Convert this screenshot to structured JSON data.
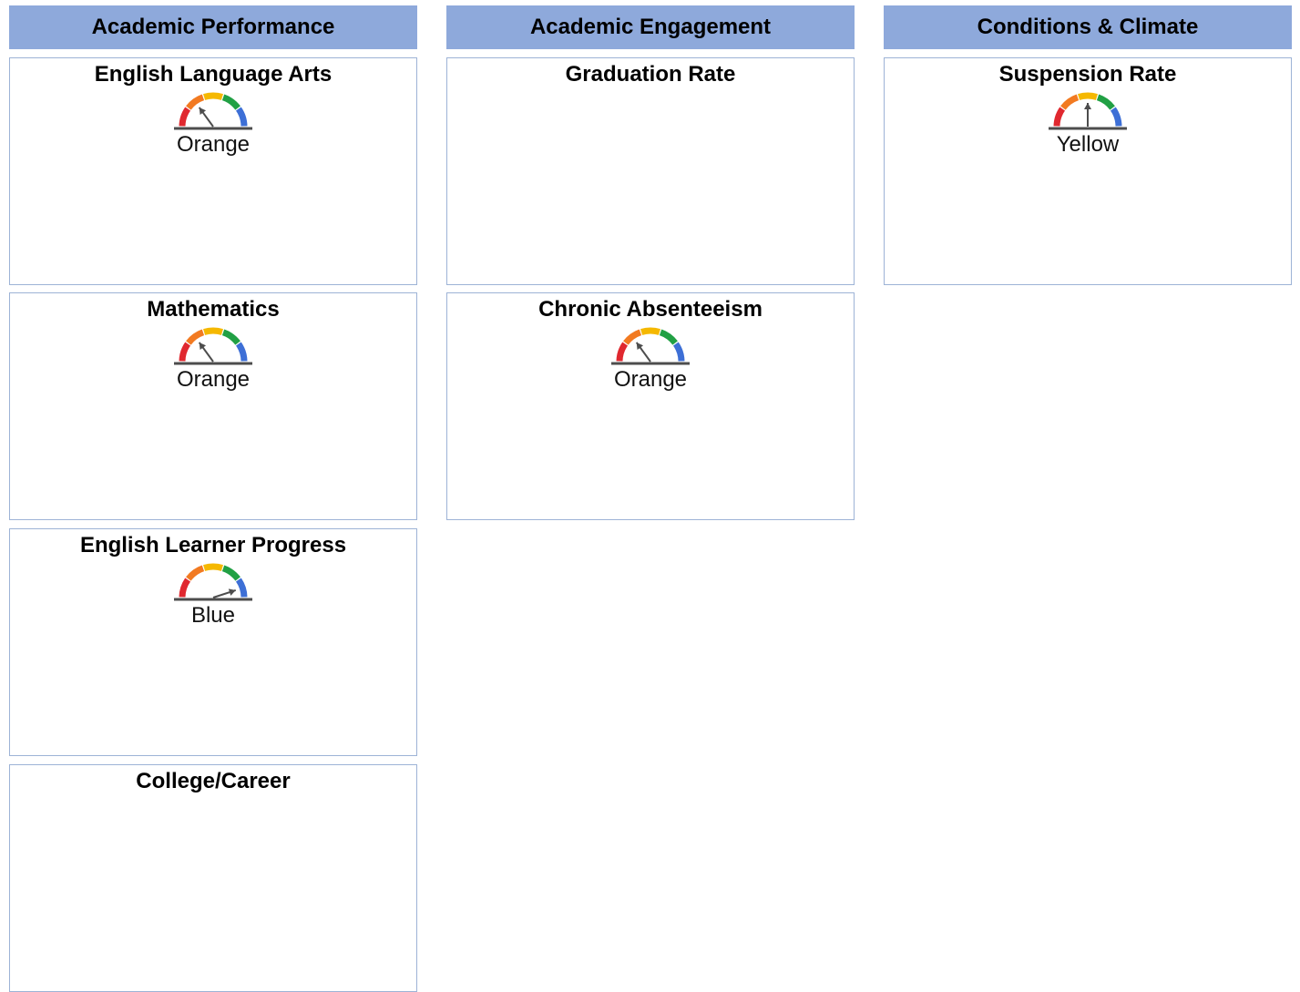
{
  "colors": {
    "header_bg": "#8ea9db",
    "card_border": "#9db3d6",
    "gauge_red": "#e0282f",
    "gauge_orange": "#f27a21",
    "gauge_yellow": "#f5b800",
    "gauge_green": "#21a044",
    "gauge_blue": "#3d6fd6",
    "needle": "#4d4d4d"
  },
  "columns": [
    {
      "title": "Academic Performance",
      "cards": [
        {
          "title": "English Language Arts",
          "status": "Orange"
        },
        {
          "title": "Mathematics",
          "status": "Orange"
        },
        {
          "title": "English Learner Progress",
          "status": "Blue"
        },
        {
          "title": "College/Career",
          "status": ""
        }
      ]
    },
    {
      "title": "Academic Engagement",
      "cards": [
        {
          "title": "Graduation Rate",
          "status": ""
        },
        {
          "title": "Chronic Absenteeism",
          "status": "Orange"
        }
      ]
    },
    {
      "title": "Conditions & Climate",
      "cards": [
        {
          "title": "Suspension Rate",
          "status": "Yellow"
        }
      ]
    }
  ]
}
